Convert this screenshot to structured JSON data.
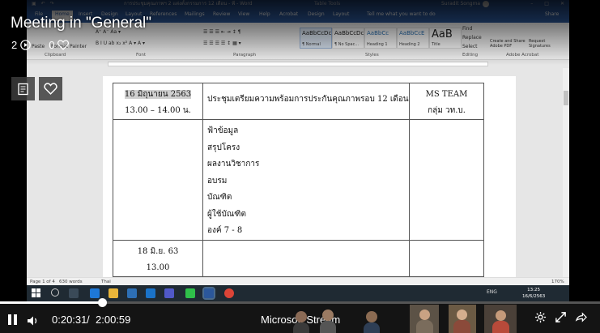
{
  "video": {
    "title": "Meeting in \"General\"",
    "views": "2",
    "likes": "0",
    "current_time": "0:20:31",
    "separator": "/",
    "total_time": "2:00:59",
    "progress_fraction": 0.17,
    "brand": "Microsoft Stream"
  },
  "word": {
    "title_text": "การประชุมคุณภาพฯ 2 แต่งตั้งกรรมการ 12 เดือน - พี - Word",
    "table_tools": "Table Tools",
    "user": "Suradit Songma",
    "tabs": [
      "File",
      "Home",
      "Insert",
      "Design",
      "Layout",
      "References",
      "Mailings",
      "Review",
      "View",
      "Help",
      "Acrobat",
      "Design",
      "Layout"
    ],
    "tell_me": "Tell me what you want to do",
    "share": "Share",
    "ribbon": {
      "paste": "Paste",
      "format_painter": "Format Painter",
      "groups": [
        "Clipboard",
        "Font",
        "Paragraph",
        "Styles",
        "Editing",
        "Adobe Acrobat"
      ],
      "styles": [
        {
          "sample": "AaBbCcDc",
          "name": "¶ Normal"
        },
        {
          "sample": "AaBbCcDc",
          "name": "¶ No Spac..."
        },
        {
          "sample": "AaBbCc",
          "name": "Heading 1"
        },
        {
          "sample": "AaBbCcE",
          "name": "Heading 2"
        },
        {
          "sample": "AaB",
          "name": "Title"
        }
      ],
      "find": "Find",
      "replace": "Replace",
      "select": "Select",
      "create_share_pdf": "Create and Share Adobe PDF",
      "request_signatures": "Request Signatures"
    },
    "table": {
      "row1": {
        "date": "16 มิถุนายน 2563",
        "time": "13.00 – 14.00 น.",
        "topic": "ประชุมเตรียมความพร้อมการประกันคุณภาพรอบ 12 เดือน",
        "where1": "MS TEAM",
        "where2": "กลุ่ม วท.บ."
      },
      "row2_items": [
        "ฟ้าข้อมูล",
        "สรุปโครง",
        "ผลงานวิชาการ",
        "อบรม",
        "บัณฑิต",
        "ผู้ใช้บัณฑิต",
        "องค์ 7 - 8"
      ],
      "row3": {
        "date": "18 มิ.ย. 63",
        "time": "13.00"
      }
    },
    "status": {
      "page": "Page 1 of 4",
      "words": "630 words",
      "lang": "Thai",
      "zoom": "170%"
    },
    "taskbar": {
      "time": "13:25",
      "date": "16/6/2563",
      "lang": "ENG"
    }
  },
  "colors": {
    "word_blue": "#2b579a",
    "controls_bg": "#141414",
    "overlay_btn": "#3c3c3c"
  }
}
